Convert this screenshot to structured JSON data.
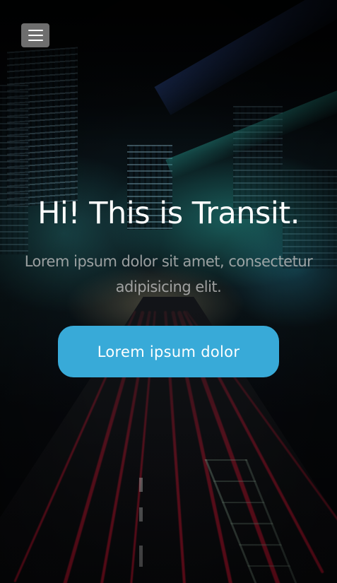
{
  "nav": {
    "menu_icon": "hamburger-menu-icon"
  },
  "hero": {
    "title": "Hi! This is Transit.",
    "subtitle": "Lorem ipsum dolor sit amet, consectetur adipisicing elit.",
    "cta_label": "Lorem ipsum dolor",
    "background_image": "night-city-traffic-light-trails"
  },
  "colors": {
    "cta_background": "#38aad8",
    "menu_button_background": "#6e6e6e",
    "title_text": "#ffffff"
  }
}
